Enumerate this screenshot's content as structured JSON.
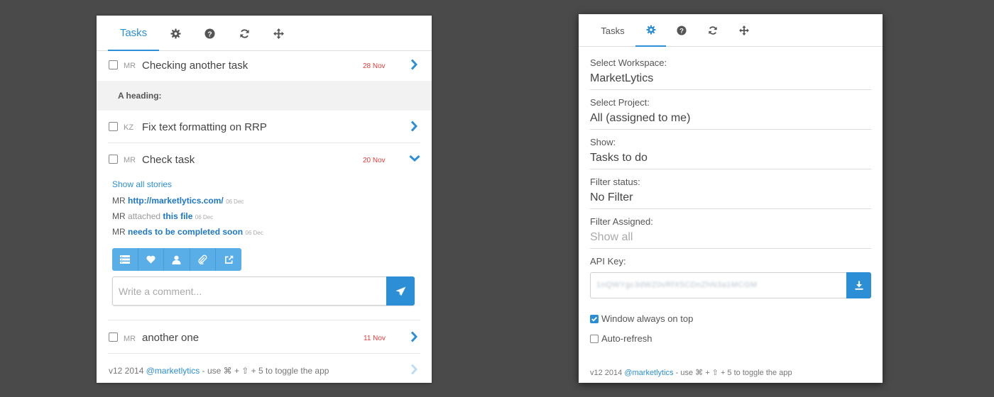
{
  "tabs": {
    "tasks_label": "Tasks",
    "icons": [
      "gear-icon",
      "question-icon",
      "refresh-icon",
      "move-icon"
    ]
  },
  "left": {
    "tasks": [
      {
        "initials": "MR",
        "title": "Checking another task",
        "date": "28 Nov",
        "expanded": false
      },
      {
        "initials": "KZ",
        "title": "Fix text formatting on RRP",
        "date": "",
        "expanded": false
      },
      {
        "initials": "MR",
        "title": "Check task",
        "date": "20 Nov",
        "expanded": true
      },
      {
        "initials": "MR",
        "title": "another one",
        "date": "11 Nov",
        "expanded": false
      }
    ],
    "heading": "A heading:",
    "show_all_stories": "Show all stories",
    "stories": [
      {
        "who": "MR",
        "verb": "",
        "text": "http://marketlytics.com/",
        "date": "06 Dec"
      },
      {
        "who": "MR",
        "verb": "attached",
        "text": "this file",
        "date": "06 Dec"
      },
      {
        "who": "MR",
        "verb": "",
        "text": "needs to be completed soon",
        "date": "06 Dec"
      }
    ],
    "action_icons": [
      "list-icon",
      "heart-icon",
      "user-icon",
      "paperclip-icon",
      "external-link-icon"
    ],
    "comment_placeholder": "Write a comment...",
    "footer": {
      "version": "v12 2014",
      "handle": "@marketlytics",
      "hint": "- use ⌘ + ⇧ + 5 to toggle the app"
    }
  },
  "right": {
    "fields": [
      {
        "label": "Select Workspace:",
        "value": "MarketLytics",
        "muted": false
      },
      {
        "label": "Select Project:",
        "value": "All (assigned to me)",
        "muted": false
      },
      {
        "label": "Show:",
        "value": "Tasks to do",
        "muted": false
      },
      {
        "label": "Filter status:",
        "value": "No Filter",
        "muted": false
      },
      {
        "label": "Filter Assigned:",
        "value": "Show all",
        "muted": true
      }
    ],
    "api_key_label": "API Key:",
    "api_key_value": "1nQWYgc3dWZ0vRfX5CDnZhN3a1MCGM",
    "options": [
      {
        "label": "Window always on top",
        "checked": true
      },
      {
        "label": "Auto-refresh",
        "checked": false
      }
    ],
    "footer": {
      "version": "v12 2014",
      "handle": "@marketlytics",
      "hint": "- use ⌘ + ⇧ + 5 to toggle the app"
    }
  },
  "colors": {
    "accent": "#2c8fd6",
    "date_red": "#e23c3c",
    "background": "#4a4a4a"
  }
}
